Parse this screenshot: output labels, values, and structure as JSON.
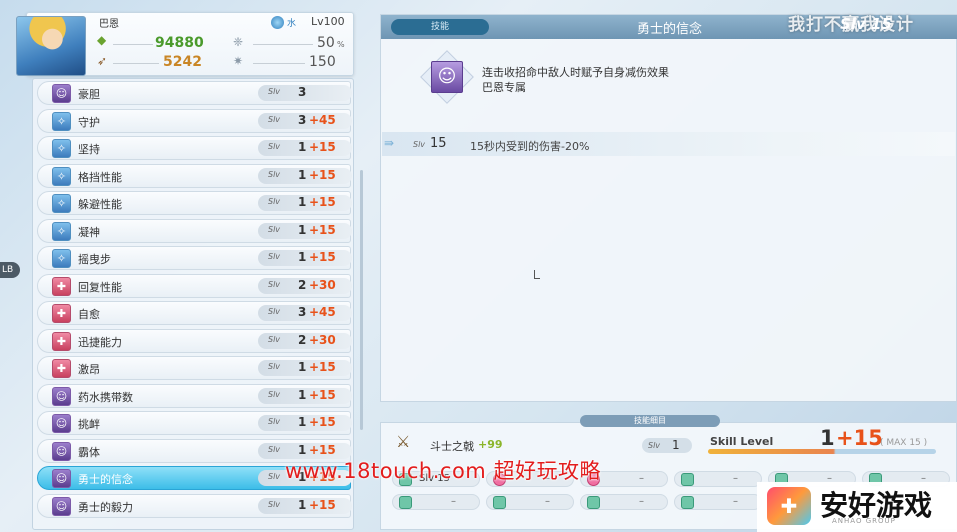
{
  "character": {
    "name": "巴恩",
    "element": "水",
    "level": "Lv100",
    "hp": "94880",
    "attack": "5242",
    "stat1": "50",
    "stat1_unit": "%",
    "stat2": "150"
  },
  "skills": [
    {
      "icon": "courage-icon",
      "label": "豪胆",
      "slv": "Slv",
      "lv": "3",
      "bonus": "",
      "color": "p"
    },
    {
      "icon": "shield-icon",
      "label": "守护",
      "slv": "Slv",
      "lv": "3",
      "bonus": "+45",
      "color": "b"
    },
    {
      "icon": "shield-icon",
      "label": "坚持",
      "slv": "Slv",
      "lv": "1",
      "bonus": "+15",
      "color": "b"
    },
    {
      "icon": "block-icon",
      "label": "格挡性能",
      "slv": "Slv",
      "lv": "1",
      "bonus": "+15",
      "color": "b"
    },
    {
      "icon": "star-icon",
      "label": "躲避性能",
      "slv": "Slv",
      "lv": "1",
      "bonus": "+15",
      "color": "b"
    },
    {
      "icon": "focus-icon",
      "label": "凝神",
      "slv": "Slv",
      "lv": "1",
      "bonus": "+15",
      "color": "b"
    },
    {
      "icon": "star-icon",
      "label": "摇曳步",
      "slv": "Slv",
      "lv": "1",
      "bonus": "+15",
      "color": "b"
    },
    {
      "icon": "heal-icon",
      "label": "回复性能",
      "slv": "Slv",
      "lv": "2",
      "bonus": "+30",
      "color": "r"
    },
    {
      "icon": "heal-icon",
      "label": "自愈",
      "slv": "Slv",
      "lv": "3",
      "bonus": "+45",
      "color": "r"
    },
    {
      "icon": "speed-icon",
      "label": "迅捷能力",
      "slv": "Slv",
      "lv": "2",
      "bonus": "+30",
      "color": "r"
    },
    {
      "icon": "rage-icon",
      "label": "激昂",
      "slv": "Slv",
      "lv": "1",
      "bonus": "+15",
      "color": "r"
    },
    {
      "icon": "potion-icon",
      "label": "药水携带数",
      "slv": "Slv",
      "lv": "1",
      "bonus": "+15",
      "color": "p"
    },
    {
      "icon": "taunt-icon",
      "label": "挑衅",
      "slv": "Slv",
      "lv": "1",
      "bonus": "+15",
      "color": "p"
    },
    {
      "icon": "armor-icon",
      "label": "霸体",
      "slv": "Slv",
      "lv": "1",
      "bonus": "+15",
      "color": "p"
    },
    {
      "icon": "warrior-belief-icon",
      "label": "勇士的信念",
      "slv": "Slv",
      "lv": "1",
      "bonus": "+15",
      "color": "p"
    },
    {
      "icon": "warrior-resolve-icon",
      "label": "勇士的毅力",
      "slv": "Slv",
      "lv": "1",
      "bonus": "+15",
      "color": "p"
    }
  ],
  "selected_skill_index": 14,
  "detail": {
    "category": "技能",
    "title": "勇士的信念",
    "slv_label": "Slv",
    "slv_value": "15",
    "desc_line1": "连击收招命中敌人时赋予自身减伤效果",
    "desc_line2": "巴恩专属",
    "effect_slv_label": "Slv",
    "effect_slv": "15",
    "effect_text": "15秒内受到的伤害-20%"
  },
  "equipment": {
    "tab_label": "技能细目",
    "weapon_name": "斗士之戟",
    "weapon_plus": "+99",
    "slv_label": "Slv",
    "slv": "1",
    "skill_level_label": "Skill Level",
    "level": "1",
    "bonus": "+15",
    "max": "MAX 15",
    "cells_row1": [
      {
        "text": "Slv 15",
        "dash": ""
      },
      {
        "text": "",
        "dash": "–"
      },
      {
        "text": "",
        "dash": "–"
      },
      {
        "text": "",
        "dash": "–"
      },
      {
        "text": "",
        "dash": "–"
      },
      {
        "text": "",
        "dash": "–"
      }
    ],
    "cells_row2": [
      {
        "text": "",
        "dash": "–"
      },
      {
        "text": "",
        "dash": "–"
      },
      {
        "text": "",
        "dash": "–"
      },
      {
        "text": "",
        "dash": "–"
      }
    ]
  },
  "watermarks": {
    "top": "我打不赢我设计",
    "url": "www.18touch.com 超好玩攻略",
    "logo": "安好游戏",
    "logo_sub": "ANHAO GROUP"
  },
  "lb_tag": "LB",
  "colors": {
    "accent": "#3cbde8",
    "bonus": "#e8521a",
    "hp": "#4a9a2c",
    "atk": "#c98626"
  }
}
